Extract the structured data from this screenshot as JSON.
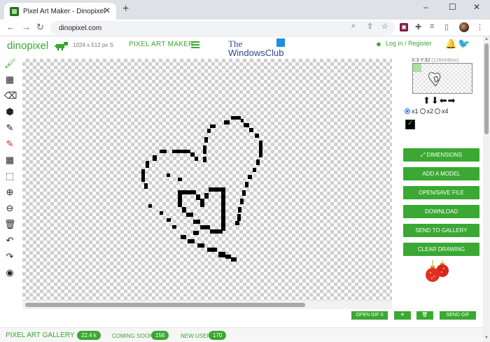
{
  "browser": {
    "tab_title": "Pixel Art Maker - Dinopixel",
    "tab_close": "✕",
    "new_tab": "+",
    "minimize": "–",
    "maximize": "☐",
    "close": "✕",
    "url": "dinopixel.com",
    "back": "←",
    "forward": "→",
    "reload": "↻"
  },
  "header": {
    "brand": "dinopixel",
    "canvas_size": "1024 x 512 px S",
    "nav_label": "PIXEL ART MAKER",
    "watermark_line1": "The",
    "watermark_line2": "WindowsClub",
    "login": "Log in / Register"
  },
  "tools": [
    {
      "name": "brush-icon",
      "glyph": "🖌"
    },
    {
      "name": "dual-brush-icon",
      "glyph": "▦"
    },
    {
      "name": "eraser-icon",
      "glyph": "⌫"
    },
    {
      "name": "fill-bucket-icon",
      "glyph": "⬢"
    },
    {
      "name": "eyedropper-icon",
      "glyph": "✎"
    },
    {
      "name": "color-picker-icon",
      "glyph": "✎"
    },
    {
      "name": "grid-icon",
      "glyph": "▦"
    },
    {
      "name": "select-icon",
      "glyph": "⬚"
    },
    {
      "name": "zoom-in-icon",
      "glyph": "⊕"
    },
    {
      "name": "zoom-out-icon",
      "glyph": "⊖"
    },
    {
      "name": "trash-icon",
      "glyph": "🗑"
    },
    {
      "name": "undo-icon",
      "glyph": "↶"
    },
    {
      "name": "redo-icon",
      "glyph": "↷"
    },
    {
      "name": "eye-icon",
      "glyph": "◉"
    }
  ],
  "panel": {
    "coords": "X:3 Y:32",
    "coords_extra": "(128x64box)",
    "arrows": "⬆⬇⬅➡",
    "zoom_options": [
      "x1",
      "x2",
      "x4"
    ],
    "zoom_selected": "x1",
    "buttons": [
      "⤢ DIMENSIONS",
      "ADD A MODEL",
      "OPEN/SAVE FILE",
      "DOWNLOAD",
      "SEND TO GALLERY",
      "CLEAR DRAWING"
    ]
  },
  "bottom": {
    "open_gif": "OPEN GIF 0",
    "add": "+",
    "delete": "🗑",
    "send_gif": "SEND GIF"
  },
  "footer": {
    "gallery": "PIXEL ART GALLERY",
    "gallery_count": "22.4 k",
    "coming_soon": "COMING SOON",
    "coming_count": "156",
    "new_user": "NEW USER",
    "new_user_count": "170"
  },
  "colors": {
    "accent": "#3aa832",
    "selected_color": "#000000"
  }
}
